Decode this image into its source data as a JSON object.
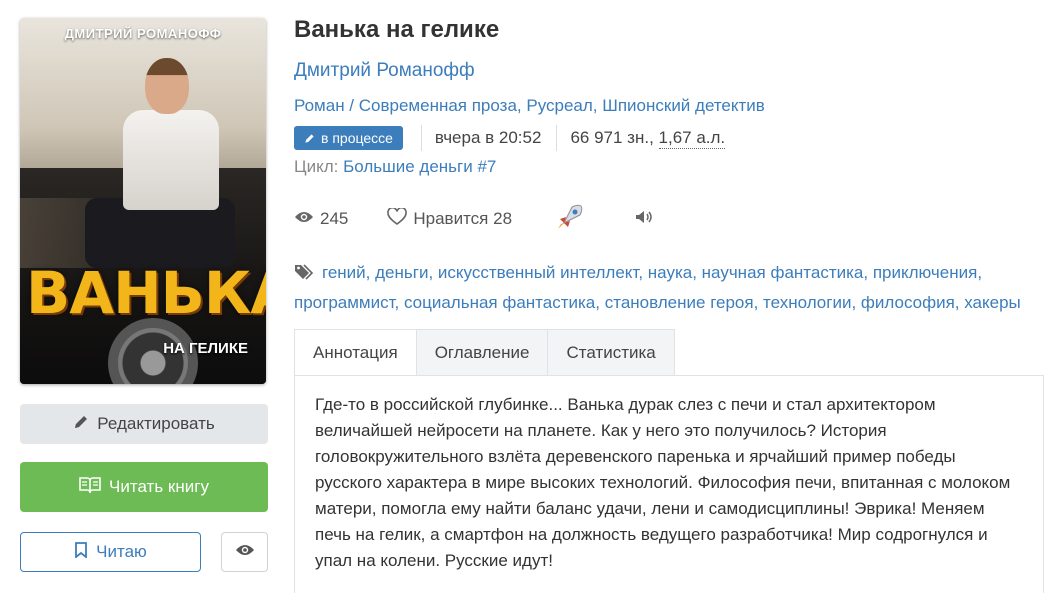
{
  "cover": {
    "author_text": "ДМИТРИЙ РОМАНОФФ",
    "title_big": "ВАНЬКА",
    "title_small": "НА ГЕЛИКЕ"
  },
  "actions": {
    "edit_label": "Редактировать",
    "read_label": "Читать книгу",
    "reading_label": "Читаю"
  },
  "book": {
    "title": "Ванька на гелике",
    "author": "Дмитрий Романофф",
    "genres": [
      "Роман",
      "Современная проза",
      "Русреал",
      "Шпионский детектив"
    ],
    "status_badge": "в процессе",
    "updated": "вчера в 20:52",
    "size": "66 971 зн., ",
    "size_al": "1,67 а.л.",
    "cycle_label": "Цикл:",
    "cycle_name": "Большие деньги #7"
  },
  "stats": {
    "views": "245",
    "likes_label": "Нравится",
    "likes": "28"
  },
  "tags": [
    "гений",
    "деньги",
    "искусственный интеллект",
    "наука",
    "научная фантастика",
    "приключения",
    "программист",
    "социальная фантастика",
    "становление героя",
    "технологии",
    "философия",
    "хакеры"
  ],
  "tabs": [
    "Аннотация",
    "Оглавление",
    "Статистика"
  ],
  "annotation": "Где-то в российской глубинке... Ванька дурак слез с печи и стал архитектором величайшей нейросети на планете. Как у него это получилось? История головокружительного взлёта деревенского паренька и ярчайший пример победы русского характера в мире высоких технологий. Философия печи, впитанная с молоком матери, помогла ему найти баланс удачи, лени и самодисциплины! Эврика! Меняем печь на гелик, а смартфон на должность ведущего разработчика! Мир содрогнулся и упал на колени. Русские идут!",
  "colors": {
    "link": "#3c7dbb",
    "read_button": "#6dbb55",
    "edit_button": "#e4e7ea"
  },
  "icons": [
    "pencil-icon",
    "open-book-icon",
    "bookmark-icon",
    "eye-icon",
    "heart-icon",
    "rocket-icon",
    "speaker-icon",
    "tag-icon"
  ]
}
